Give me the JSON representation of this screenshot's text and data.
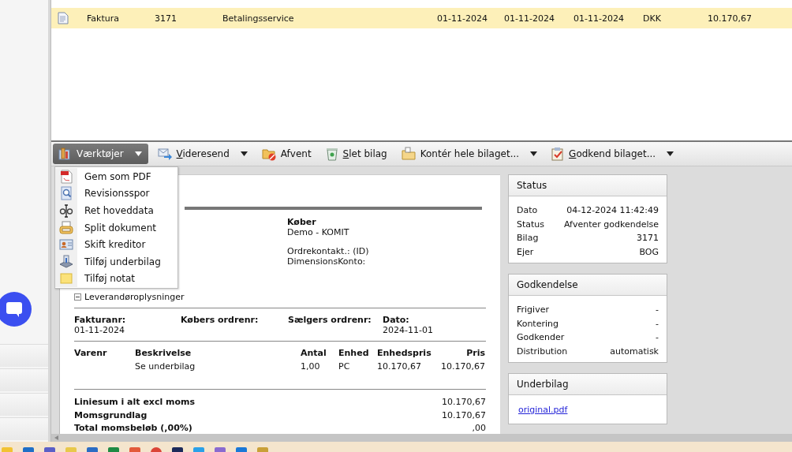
{
  "list_rows": [
    {
      "kind": "document",
      "type": "Faktura",
      "number": "3171",
      "payment": "Betalingsservice",
      "date_1": "01-11-2024",
      "date_2": "01-11-2024",
      "date_3": "01-11-2024",
      "currency": "DKK",
      "amount": "10.170,67",
      "selected": true
    }
  ],
  "toolbar": [
    {
      "kind": "tools",
      "label": "Værktøjer",
      "underline_first": false,
      "dropdown": true,
      "active": true
    },
    {
      "kind": "forward",
      "label": "Videresend",
      "underline_first": true,
      "dropdown": true,
      "active": false
    },
    {
      "kind": "pause",
      "label": "Afvent",
      "underline_first": false,
      "dropdown": false,
      "active": false
    },
    {
      "kind": "trash",
      "label": "Slet bilag",
      "underline_first": true,
      "dropdown": false,
      "active": false
    },
    {
      "kind": "folder",
      "label": "Kontér hele bilaget...",
      "underline_first": false,
      "dropdown": true,
      "active": false
    },
    {
      "kind": "clipboard",
      "label": "Godkend bilaget...",
      "underline_first": true,
      "dropdown": true,
      "active": false
    }
  ],
  "tools_menu": [
    {
      "kind": "pdf",
      "label": "Gem som PDF"
    },
    {
      "kind": "magnifier",
      "label": "Revisionsspor"
    },
    {
      "kind": "text",
      "label": "Ret hoveddata"
    },
    {
      "kind": "printer",
      "label": "Split dokument"
    },
    {
      "kind": "card",
      "label": "Skift kreditor"
    },
    {
      "kind": "disk",
      "label": "Tilføj underbilag"
    },
    {
      "kind": "note",
      "label": "Tilføj notat"
    }
  ],
  "document": {
    "buyer": {
      "heading": "Køber",
      "name_lines": [
        "Demo - KOMIT"
      ],
      "contact_lines": [
        "Ordrekontakt.: (ID)",
        "DimensionsKonto:"
      ]
    },
    "supplier_toggle": "Leverandøroplysninger",
    "meta": [
      {
        "label": "Fakturanr:",
        "value": "01-11-2024"
      },
      {
        "label": "Købers ordrenr:"
      },
      {
        "label": "Sælgers ordrenr:"
      },
      {
        "label": "Dato:",
        "value": "2024-11-01"
      }
    ],
    "line_columns": [
      "Varenr",
      "Beskrivelse",
      "Antal",
      "Enhed",
      "Enhedspris",
      "Pris"
    ],
    "line_rows": [
      [
        null,
        "Se underbilag",
        "1,00",
        "PC",
        "10.170,67",
        "10.170,67"
      ]
    ],
    "totals": [
      {
        "label": "Liniesum i alt excl moms",
        "value": "10.170,67"
      },
      {
        "label": "Momsgrundlag",
        "value": "10.170,67"
      },
      {
        "label": "Total momsbeløb (,00%)",
        "value": ",00"
      }
    ]
  },
  "cards": [
    {
      "title": "Status",
      "rows": [
        {
          "label": "Dato",
          "value": "04-12-2024 11:42:49"
        },
        {
          "label": "Status",
          "value": "Afventer godkendelse"
        },
        {
          "label": "Bilag",
          "value": "3171"
        },
        {
          "label": "Ejer",
          "value": "BOG"
        }
      ]
    },
    {
      "title": "Godkendelse",
      "rows": [
        {
          "label": "Frigiver",
          "value": "-"
        },
        {
          "label": "Kontering",
          "value": "-"
        },
        {
          "label": "Godkender",
          "value": "-"
        },
        {
          "label": "Distribution",
          "value": "automatisk"
        }
      ]
    },
    {
      "title": "Underbilag",
      "links": [
        "original.pdf"
      ]
    }
  ]
}
